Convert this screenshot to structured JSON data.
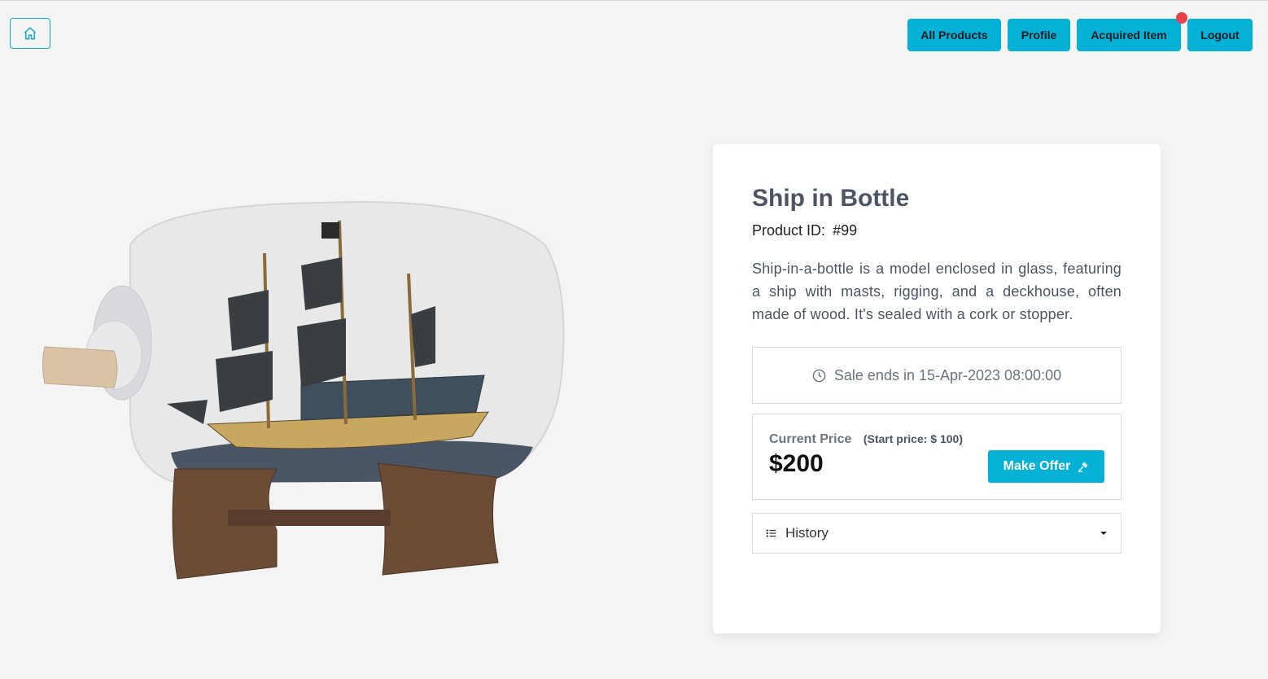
{
  "nav": {
    "home_icon": "home-icon",
    "buttons": [
      "All Products",
      "Profile",
      "Acquired Item",
      "Logout"
    ]
  },
  "product": {
    "title": "Ship in Bottle",
    "id_label": "Product ID:",
    "id_value": "#99",
    "description": "Ship-in-a-bottle is a model enclosed in glass, featuring a ship with masts, rigging, and a deckhouse, often made of wood. It's sealed with a cork or stopper.",
    "sale_text": "Sale ends in 15-Apr-2023 08:00:00",
    "current_price_label": "Current Price",
    "start_price": "(Start price: $ 100)",
    "current_price": "$200",
    "offer_button": "Make Offer",
    "history_label": "History"
  },
  "colors": {
    "accent": "#05b2d6",
    "notification": "#e8414a"
  }
}
